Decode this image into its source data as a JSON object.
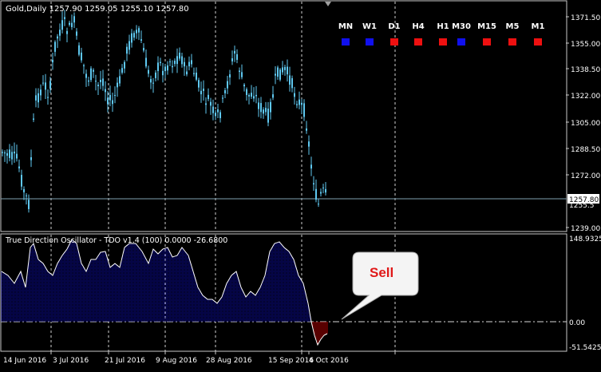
{
  "main": {
    "header": "Gold,Daily  1257.90 1259.05 1255.10 1257.80",
    "price_current": "1257.80",
    "price_axis": [
      "1371.50",
      "1355.00",
      "1338.50",
      "1322.00",
      "1305.00",
      "1288.50",
      "1272.00",
      "1239.00"
    ],
    "price_partial": "1255.5"
  },
  "timeframes": [
    {
      "label": "MN",
      "color": "#1010ee"
    },
    {
      "label": "W1",
      "color": "#1010ee"
    },
    {
      "label": "D1",
      "color": "#ee1010"
    },
    {
      "label": "H4",
      "color": "#ee1010"
    },
    {
      "label": "H1",
      "color": "#ee1010"
    },
    {
      "label": "M30",
      "color": "#1010ee"
    },
    {
      "label": "M15",
      "color": "#ee1010"
    },
    {
      "label": "M5",
      "color": "#ee1010"
    },
    {
      "label": "M1",
      "color": "#ee1010"
    }
  ],
  "indicator": {
    "title": "True Direction Oscillator - TDO v1.4 (100) 0.0000 -26.6800",
    "axis_top": "148.9325",
    "axis_zero": "0.00",
    "axis_bottom": "-51.5425"
  },
  "bubble": {
    "text": "Sell"
  },
  "x_axis": {
    "dates": [
      "14 Jun 2016",
      "3 Jul 2016",
      "21 Jul 2016",
      "9 Aug 2016",
      "28 Aug 2016",
      "15 Sep 2016",
      "4 Oct 2016"
    ]
  },
  "colors": {
    "candle": "#5fc8f0",
    "osc_fill_up": "#0a0a8c",
    "osc_fill_down": "#b00000",
    "frame": "#c8c8c8"
  }
}
